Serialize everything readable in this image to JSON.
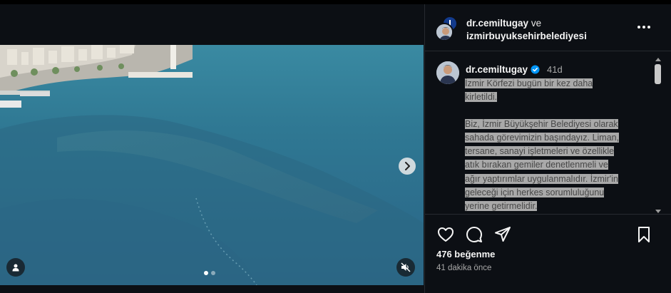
{
  "post": {
    "header": {
      "user1": "dr.cemiltugay",
      "joiner": "ve",
      "user2": "izmirbuyuksehirbelediyesi"
    },
    "comment": {
      "username": "dr.cemiltugay",
      "time": "41d",
      "caption_para1": [
        "İzmir Körfezi bugün bir kez daha",
        "kirletildi."
      ],
      "caption_para2": [
        "Biz, İzmir Büyükşehir Belediyesi olarak",
        "sahada görevimizin başındayız. Liman,",
        "tersane, sanayi işletmeleri ve özellikle",
        "atık bırakan gemiler denetlenmeli ve",
        "ağır yaptırımlar uygulanmalıdır. İzmir'in",
        "geleceği için herkes sorumluluğunu",
        "yerine getirmelidir."
      ]
    },
    "likes": "476 beğenme",
    "posted_ago": "41 dakika önce",
    "carousel": {
      "current": 1,
      "total": 2
    }
  },
  "icons": {
    "next": "chevron-right-icon",
    "user_tag": "person-icon",
    "mute": "speaker-muted-icon",
    "more": "more-horizontal-icon",
    "like": "heart-icon",
    "comment": "comment-icon",
    "share": "paper-plane-icon",
    "save": "bookmark-icon",
    "verified": "verified-badge-icon"
  },
  "colors": {
    "background": "#0c0f14",
    "verified": "#0095f6",
    "muted_text": "#a8a8a8",
    "sea": "#2a6a84"
  }
}
